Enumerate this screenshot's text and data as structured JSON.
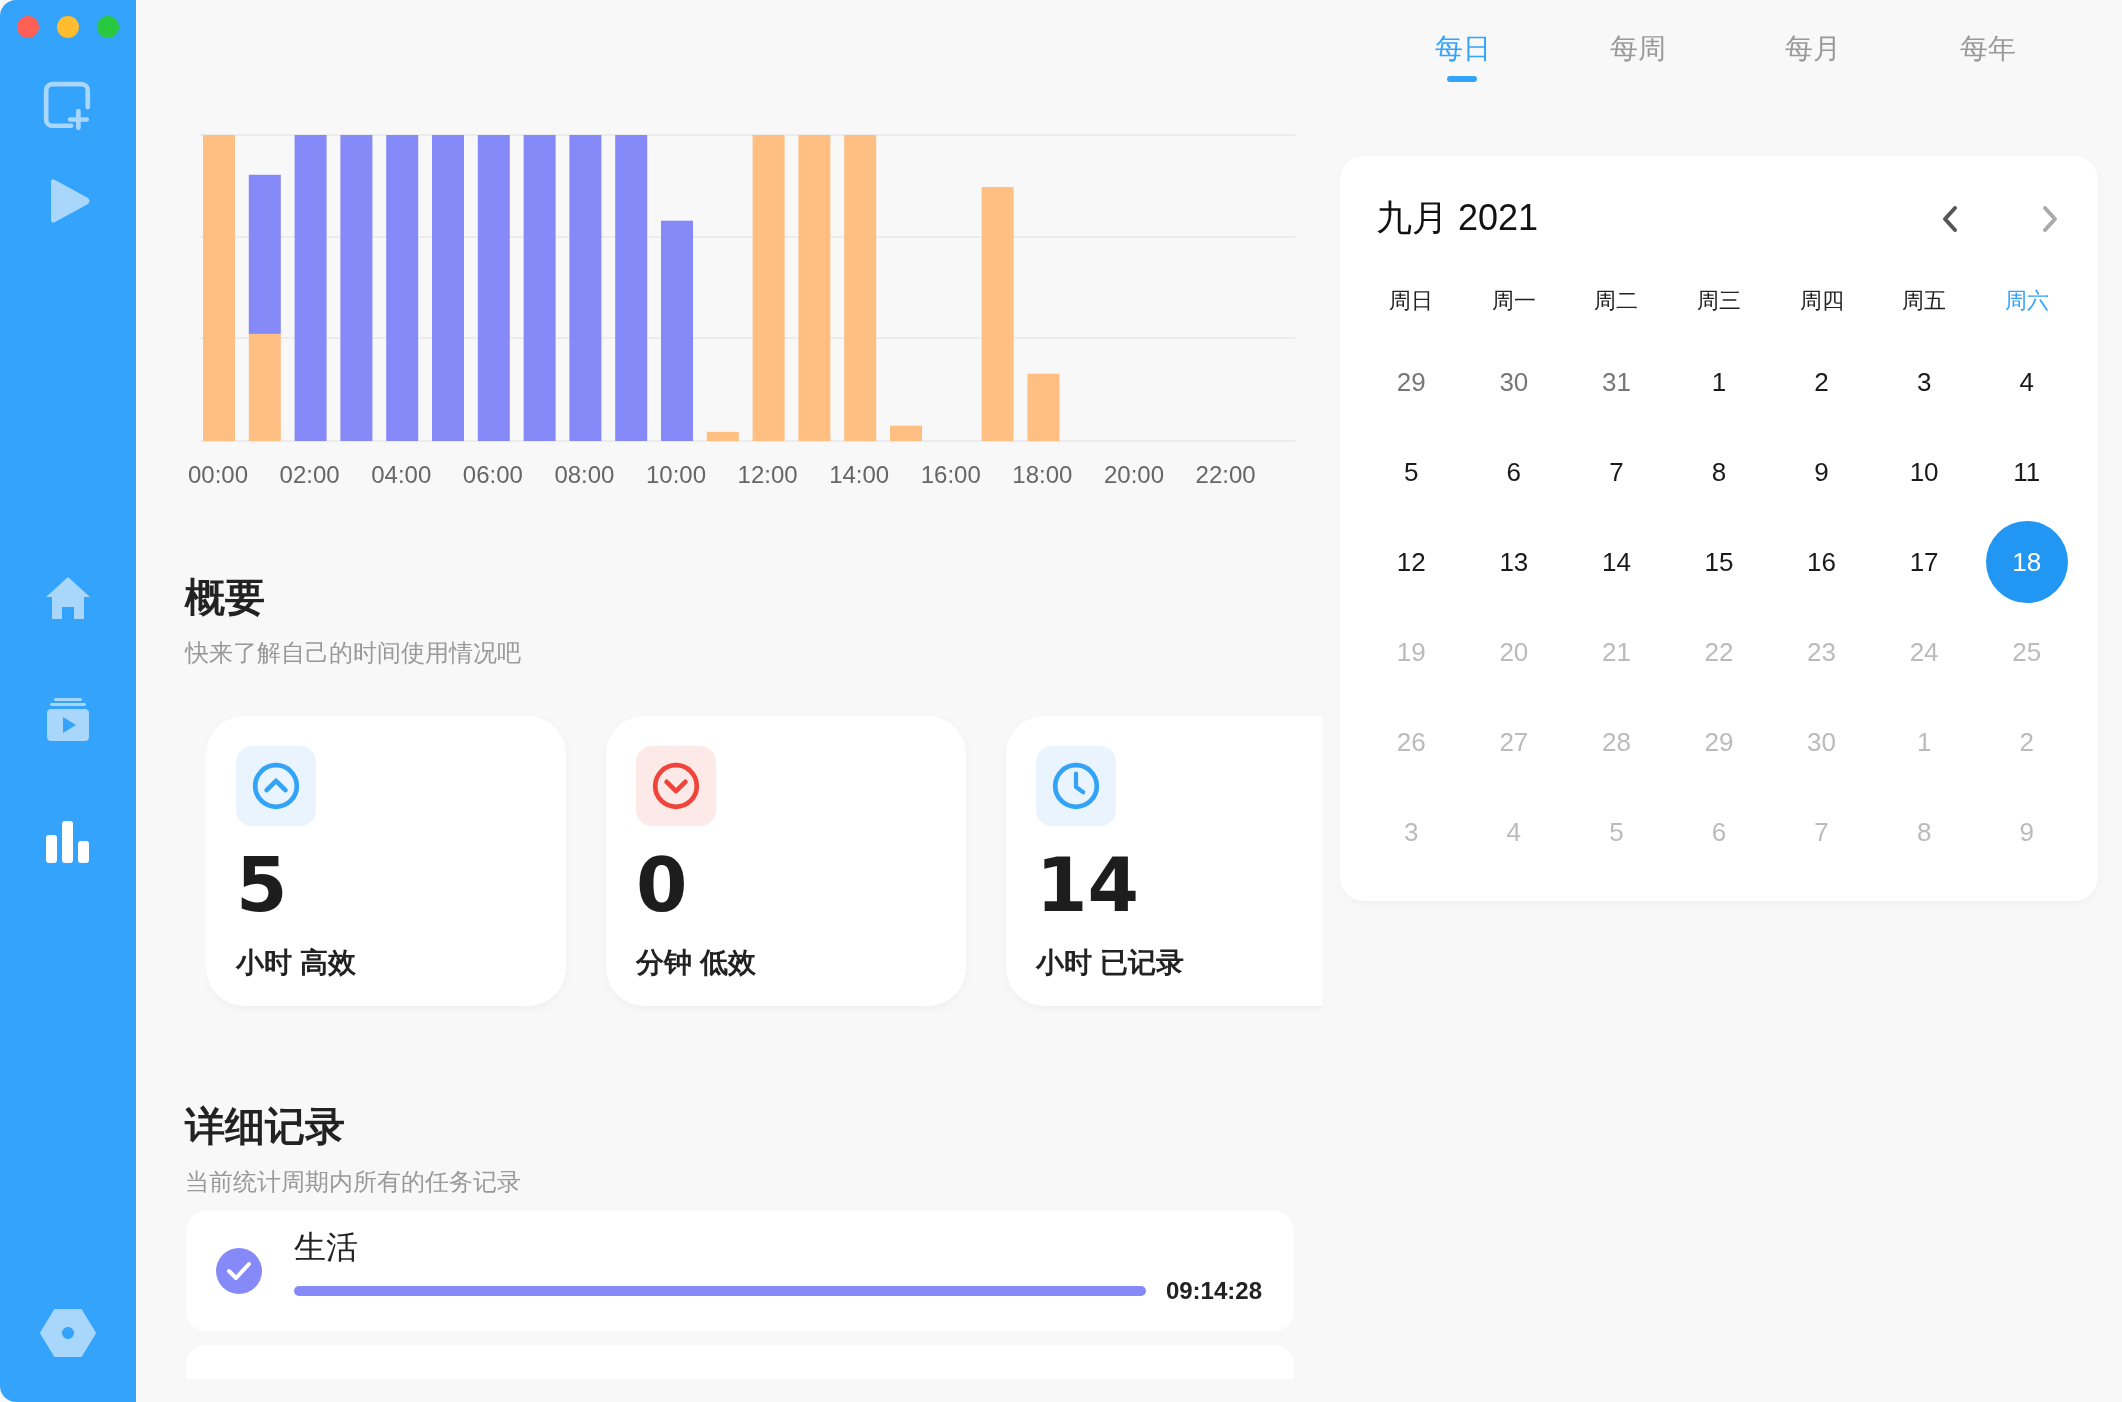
{
  "sidebar": {
    "items": [
      {
        "kind": "home",
        "selected": false
      },
      {
        "kind": "videos",
        "selected": false
      },
      {
        "kind": "stats",
        "selected": true
      }
    ]
  },
  "chart": {
    "hour_labels": [
      "00:00",
      "02:00",
      "04:00",
      "06:00",
      "08:00",
      "10:00",
      "12:00",
      "14:00",
      "16:00",
      "18:00",
      "20:00",
      "22:00"
    ]
  },
  "overview": {
    "title": "概要",
    "subtitle": "快来了解自己的时间使用情况吧",
    "cards": [
      {
        "kind": "up",
        "value": "5",
        "label": "小时 高效"
      },
      {
        "kind": "down",
        "value": "0",
        "label": "分钟 低效"
      },
      {
        "kind": "clock",
        "value": "14",
        "label": "小时 已记录"
      }
    ]
  },
  "details": {
    "title": "详细记录",
    "subtitle": "当前统计周期内所有的任务记录",
    "records": [
      {
        "title": "生活",
        "done": true,
        "level": 1.0,
        "duration": "09:14:28"
      }
    ]
  },
  "tabs": [
    {
      "label": "每日",
      "selected": true
    },
    {
      "label": "每周",
      "selected": false
    },
    {
      "label": "每月",
      "selected": false
    },
    {
      "label": "每年",
      "selected": false
    }
  ],
  "calendar": {
    "title": "九月 2021",
    "weekdays": [
      {
        "label": "周日",
        "highlighted": false
      },
      {
        "label": "周一",
        "highlighted": false
      },
      {
        "label": "周二",
        "highlighted": false
      },
      {
        "label": "周三",
        "highlighted": false
      },
      {
        "label": "周四",
        "highlighted": false
      },
      {
        "label": "周五",
        "highlighted": false
      },
      {
        "label": "周六",
        "highlighted": true
      }
    ],
    "days": [
      {
        "label": "29",
        "kind": "adjacent",
        "selected": false
      },
      {
        "label": "30",
        "kind": "adjacent",
        "selected": false
      },
      {
        "label": "31",
        "kind": "adjacent",
        "selected": false
      },
      {
        "label": "1",
        "kind": "past",
        "selected": false
      },
      {
        "label": "2",
        "kind": "past",
        "selected": false
      },
      {
        "label": "3",
        "kind": "past",
        "selected": false
      },
      {
        "label": "4",
        "kind": "past",
        "selected": false
      },
      {
        "label": "5",
        "kind": "past",
        "selected": false
      },
      {
        "label": "6",
        "kind": "past",
        "selected": false
      },
      {
        "label": "7",
        "kind": "past",
        "selected": false
      },
      {
        "label": "8",
        "kind": "past",
        "selected": false
      },
      {
        "label": "9",
        "kind": "past",
        "selected": false
      },
      {
        "label": "10",
        "kind": "past",
        "selected": false
      },
      {
        "label": "11",
        "kind": "past",
        "selected": false
      },
      {
        "label": "12",
        "kind": "past",
        "selected": false
      },
      {
        "label": "13",
        "kind": "past",
        "selected": false
      },
      {
        "label": "14",
        "kind": "past",
        "selected": false
      },
      {
        "label": "15",
        "kind": "past",
        "selected": false
      },
      {
        "label": "16",
        "kind": "past",
        "selected": false
      },
      {
        "label": "17",
        "kind": "past",
        "selected": false
      },
      {
        "label": "18",
        "kind": "past",
        "selected": true
      },
      {
        "label": "19",
        "kind": "future",
        "selected": false
      },
      {
        "label": "20",
        "kind": "future",
        "selected": false
      },
      {
        "label": "21",
        "kind": "future",
        "selected": false
      },
      {
        "label": "22",
        "kind": "future",
        "selected": false
      },
      {
        "label": "23",
        "kind": "future",
        "selected": false
      },
      {
        "label": "24",
        "kind": "future",
        "selected": false
      },
      {
        "label": "25",
        "kind": "future",
        "selected": false
      },
      {
        "label": "26",
        "kind": "future",
        "selected": false
      },
      {
        "label": "27",
        "kind": "future",
        "selected": false
      },
      {
        "label": "28",
        "kind": "future",
        "selected": false
      },
      {
        "label": "29",
        "kind": "future",
        "selected": false
      },
      {
        "label": "30",
        "kind": "future",
        "selected": false
      },
      {
        "label": "1",
        "kind": "future",
        "selected": false
      },
      {
        "label": "2",
        "kind": "future",
        "selected": false
      },
      {
        "label": "3",
        "kind": "future",
        "selected": false
      },
      {
        "label": "4",
        "kind": "future",
        "selected": false
      },
      {
        "label": "5",
        "kind": "future",
        "selected": false
      },
      {
        "label": "6",
        "kind": "future",
        "selected": false
      },
      {
        "label": "7",
        "kind": "future",
        "selected": false
      },
      {
        "label": "8",
        "kind": "future",
        "selected": false
      },
      {
        "label": "9",
        "kind": "future",
        "selected": false
      }
    ]
  }
}
